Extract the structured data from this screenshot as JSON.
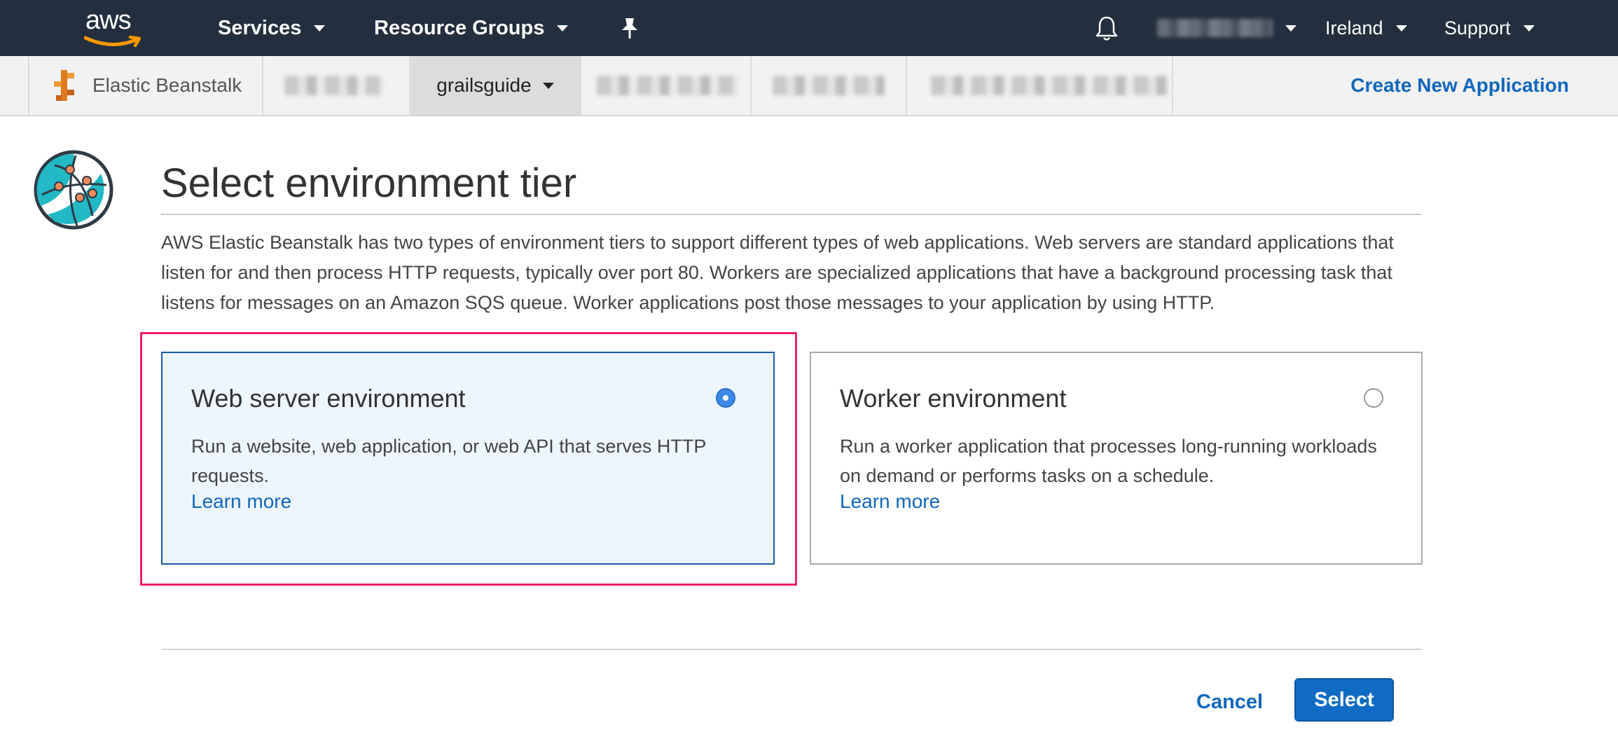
{
  "topnav": {
    "logo_text": "aws",
    "services_label": "Services",
    "resource_groups_label": "Resource Groups",
    "region_label": "Ireland",
    "support_label": "Support"
  },
  "subnav": {
    "service_name": "Elastic Beanstalk",
    "app_label": "grailsguide",
    "create_app_label": "Create New Application"
  },
  "page": {
    "title": "Select environment tier",
    "description": "AWS Elastic Beanstalk has two types of environment tiers to support different types of web applications. Web servers are standard applications that listen for and then process HTTP requests, typically over port 80. Workers are specialized applications that have a background processing task that listens for messages on an Amazon SQS queue. Worker applications post those messages to your application by using HTTP."
  },
  "tiers": [
    {
      "title": "Web server environment",
      "description": "Run a website, web application, or web API that serves HTTP requests.",
      "link": "Learn more",
      "selected": true
    },
    {
      "title": "Worker environment",
      "description": "Run a worker application that processes long-running workloads on demand or performs tasks on a schedule.",
      "link": "Learn more",
      "selected": false
    }
  ],
  "actions": {
    "cancel_label": "Cancel",
    "select_label": "Select"
  },
  "colors": {
    "nav_bg": "#232f3e",
    "aws_orange": "#ff9900",
    "link_blue": "#1166bb",
    "highlight_pink": "#ec1f6a",
    "selected_card_bg": "#eef6fd",
    "primary_button": "#0f6bc4"
  },
  "icons": [
    "aws-logo",
    "bell-icon",
    "pin-icon",
    "beanstalk-icon",
    "globe-network-icon"
  ]
}
